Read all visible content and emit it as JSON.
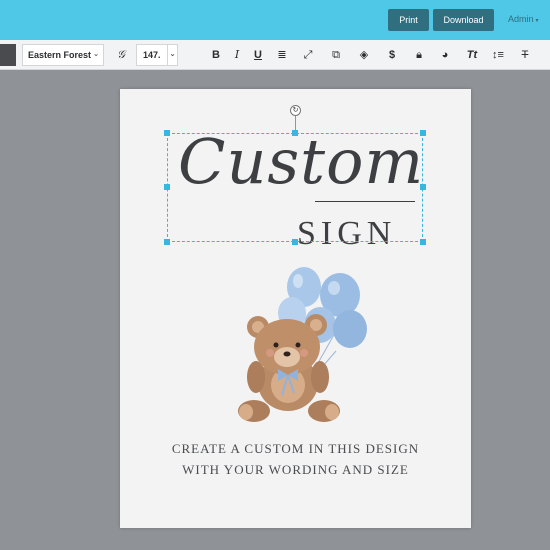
{
  "header": {
    "print_label": "Print",
    "download_label": "Download",
    "admin_label": "Admin",
    "bar_color": "#4ec8e6",
    "button_color": "#2f6f80"
  },
  "toolbar": {
    "font_name": "Eastern Forest",
    "font_size": "147.",
    "tools": [
      "font-style-icon",
      "bold-icon",
      "italic-icon",
      "underline-icon",
      "align-icon",
      "resize-icon",
      "duplicate-icon",
      "layers-icon",
      "dollar-icon",
      "lock-icon",
      "color-icon",
      "text-transform-icon",
      "line-height-icon",
      "text-strike-icon"
    ]
  },
  "canvas": {
    "script_text": "Custom",
    "sign_text": "SIGN",
    "caption_line1": "CREATE A CUSTOM IN THIS DESIGN",
    "caption_line2": "WITH YOUR WORDING AND SIZE",
    "selection_color": "#39b6dd"
  }
}
